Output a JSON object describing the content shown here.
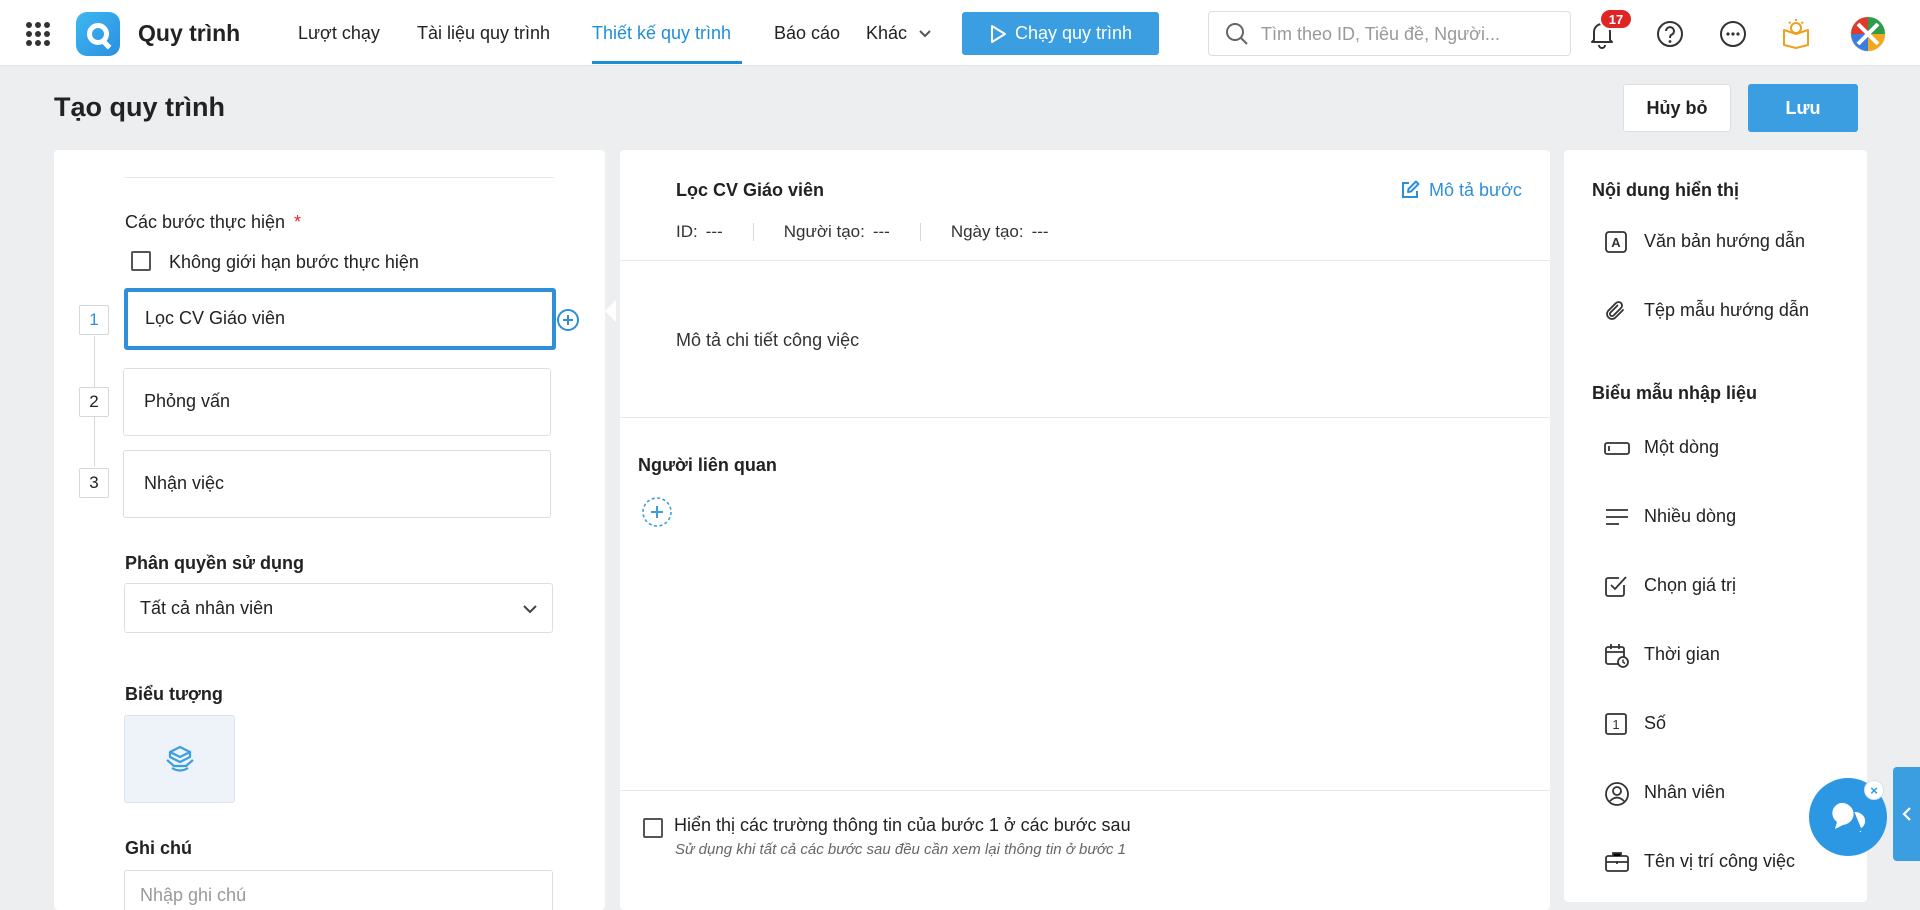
{
  "nav": {
    "app_title": "Quy trình",
    "items": [
      "Lượt chạy",
      "Tài liệu quy trình",
      "Thiết kế quy trình",
      "Báo cáo",
      "Khác"
    ],
    "run_button": "Chạy quy trình",
    "search_placeholder": "Tìm theo ID, Tiêu đề, Người...",
    "notification_count": "17"
  },
  "header": {
    "title": "Tạo quy trình",
    "cancel": "Hủy bỏ",
    "save": "Lưu"
  },
  "left": {
    "steps_label": "Các bước thực hiện",
    "required_mark": "*",
    "unlimited_label": "Không giới hạn bước thực hiện",
    "steps": [
      {
        "num": "1",
        "name": "Lọc CV Giáo viên"
      },
      {
        "num": "2",
        "name": "Phỏng vấn"
      },
      {
        "num": "3",
        "name": "Nhận việc"
      }
    ],
    "permission_label": "Phân quyền sử dụng",
    "permission_value": "Tất cả nhân viên",
    "icon_label": "Biểu tượng",
    "note_label": "Ghi chú",
    "note_placeholder": "Nhập ghi chú"
  },
  "center": {
    "step_title": "Lọc CV Giáo viên",
    "describe_link": "Mô tả bước",
    "id_label": "ID:",
    "id_value": "---",
    "creator_label": "Người tạo:",
    "creator_value": "---",
    "date_label": "Ngày tạo:",
    "date_value": "---",
    "description_placeholder": "Mô tả chi tiết công việc",
    "related_label": "Người liên quan",
    "show_fields_label": "Hiển thị các trường thông tin của bước 1 ở các bước sau",
    "show_fields_hint": "Sử dụng khi tất cả các bước sau đều cần xem lại thông tin ở bước 1"
  },
  "right": {
    "display_title": "Nội dung hiển thị",
    "display_items": [
      {
        "icon": "text-a-icon",
        "label": "Văn bản hướng dẫn"
      },
      {
        "icon": "paperclip-icon",
        "label": "Tệp mẫu hướng dẫn"
      }
    ],
    "form_title": "Biểu mẫu nhập liệu",
    "form_items": [
      {
        "icon": "single-line-icon",
        "label": "Một dòng"
      },
      {
        "icon": "multi-line-icon",
        "label": "Nhiều dòng"
      },
      {
        "icon": "checkbox-icon",
        "label": "Chọn giá trị"
      },
      {
        "icon": "calendar-icon",
        "label": "Thời gian"
      },
      {
        "icon": "number-icon",
        "label": "Số"
      },
      {
        "icon": "user-circle-icon",
        "label": "Nhân viên"
      },
      {
        "icon": "briefcase-icon",
        "label": "Tên vị trí công việc"
      }
    ]
  },
  "colors": {
    "accent": "#3a9ee0",
    "active_nav": "#1e8fd6",
    "badge": "#e02424"
  }
}
